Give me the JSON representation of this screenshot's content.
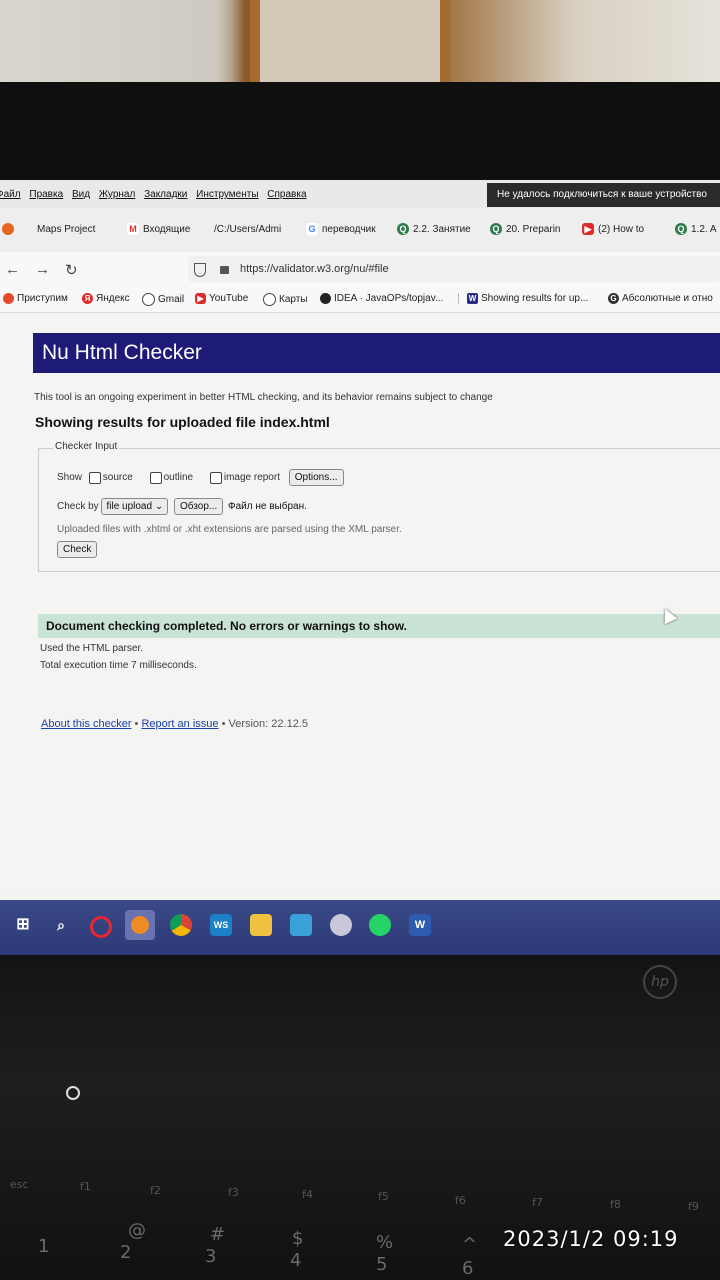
{
  "menu": {
    "items": [
      "Файл",
      "Правка",
      "Вид",
      "Журнал",
      "Закладки",
      "Инструменты",
      "Справка"
    ],
    "notification": "Не удалось подключиться к ваше устройство"
  },
  "tabs": [
    {
      "label": "Maps Project",
      "icon": "firefox-icon"
    },
    {
      "label": "Входящие",
      "icon": "gmail-icon"
    },
    {
      "label": "/C:/Users/Admi",
      "icon": "file-icon"
    },
    {
      "label": "переводчик",
      "icon": "google-icon"
    },
    {
      "label": "2.2. Занятие",
      "icon": "q-icon"
    },
    {
      "label": "20. Preparin",
      "icon": "q-icon"
    },
    {
      "label": "(2) How to",
      "icon": "youtube-icon"
    },
    {
      "label": "1.2. A",
      "icon": "q-icon"
    }
  ],
  "navbar": {
    "url": "https://validator.w3.org/nu/#file"
  },
  "bookmarks": [
    {
      "label": "Приступим",
      "color": "#e34a2a"
    },
    {
      "label": "Яндекс",
      "color": "#e02b2b"
    },
    {
      "label": "Gmail",
      "color": "#444444"
    },
    {
      "label": "YouTube",
      "color": "#e02b2b"
    },
    {
      "label": "Карты",
      "color": "#444444"
    },
    {
      "label": "IDEA · JavaOPs/topjav...",
      "color": "#222222"
    },
    {
      "label": "Showing results for up...",
      "color": "#2b2b8a"
    },
    {
      "label": "Абсолютные и отно",
      "color": "#333333"
    }
  ],
  "page": {
    "banner_title": "Nu Html Checker",
    "subnote": "This tool is an ongoing experiment in better HTML checking, and its behavior remains subject to change",
    "heading": "Showing results for uploaded file index.html",
    "checker": {
      "legend": "Checker Input",
      "show_label": "Show",
      "opt_source": "source",
      "opt_outline": "outline",
      "opt_image_report": "image report",
      "options_button": "Options...",
      "check_by_label": "Check by",
      "check_by_value": "file upload",
      "browse_button": "Обзор...",
      "no_file": "Файл не выбран.",
      "xml_note": "Uploaded files with .xhtml or .xht extensions are parsed using the XML parser.",
      "check_button": "Check"
    },
    "result": "Document checking completed. No errors or warnings to show.",
    "parser_info": "Used the HTML parser.",
    "time_info": "Total execution time 7 milliseconds.",
    "footer": {
      "about": "About this checker",
      "sep1": " • ",
      "report": "Report an issue",
      "version": " • Version: 22.12.5"
    }
  },
  "taskbar": [
    {
      "icon": "windows-icon",
      "color": "#ffffff"
    },
    {
      "icon": "search-icon",
      "color": "#ffffff"
    },
    {
      "icon": "opera-icon",
      "color": "#e8262f"
    },
    {
      "icon": "firefox-icon",
      "color": "#f08a24"
    },
    {
      "icon": "chrome-icon",
      "color": "#3a9b3f"
    },
    {
      "icon": "webstorm-icon",
      "color": "#1b80c8"
    },
    {
      "icon": "explorer-icon",
      "color": "#f0c040"
    },
    {
      "icon": "store-icon",
      "color": "#3aa0d8"
    },
    {
      "icon": "app-icon",
      "color": "#c24"
    },
    {
      "icon": "whatsapp-icon",
      "color": "#25d366"
    },
    {
      "icon": "word-icon",
      "color": "#2b5cad"
    }
  ],
  "keyboard": {
    "fn_keys": [
      "esc",
      "f1",
      "f2",
      "f3",
      "f4",
      "f5",
      "f6",
      "f7",
      "f8",
      "f9"
    ],
    "number_keys": [
      "1",
      "2",
      "3",
      "4",
      "5",
      "6"
    ],
    "symbol_keys": [
      "@",
      "#",
      "$",
      "%",
      "^"
    ]
  },
  "timestamp": "2023/1/2  09:19"
}
